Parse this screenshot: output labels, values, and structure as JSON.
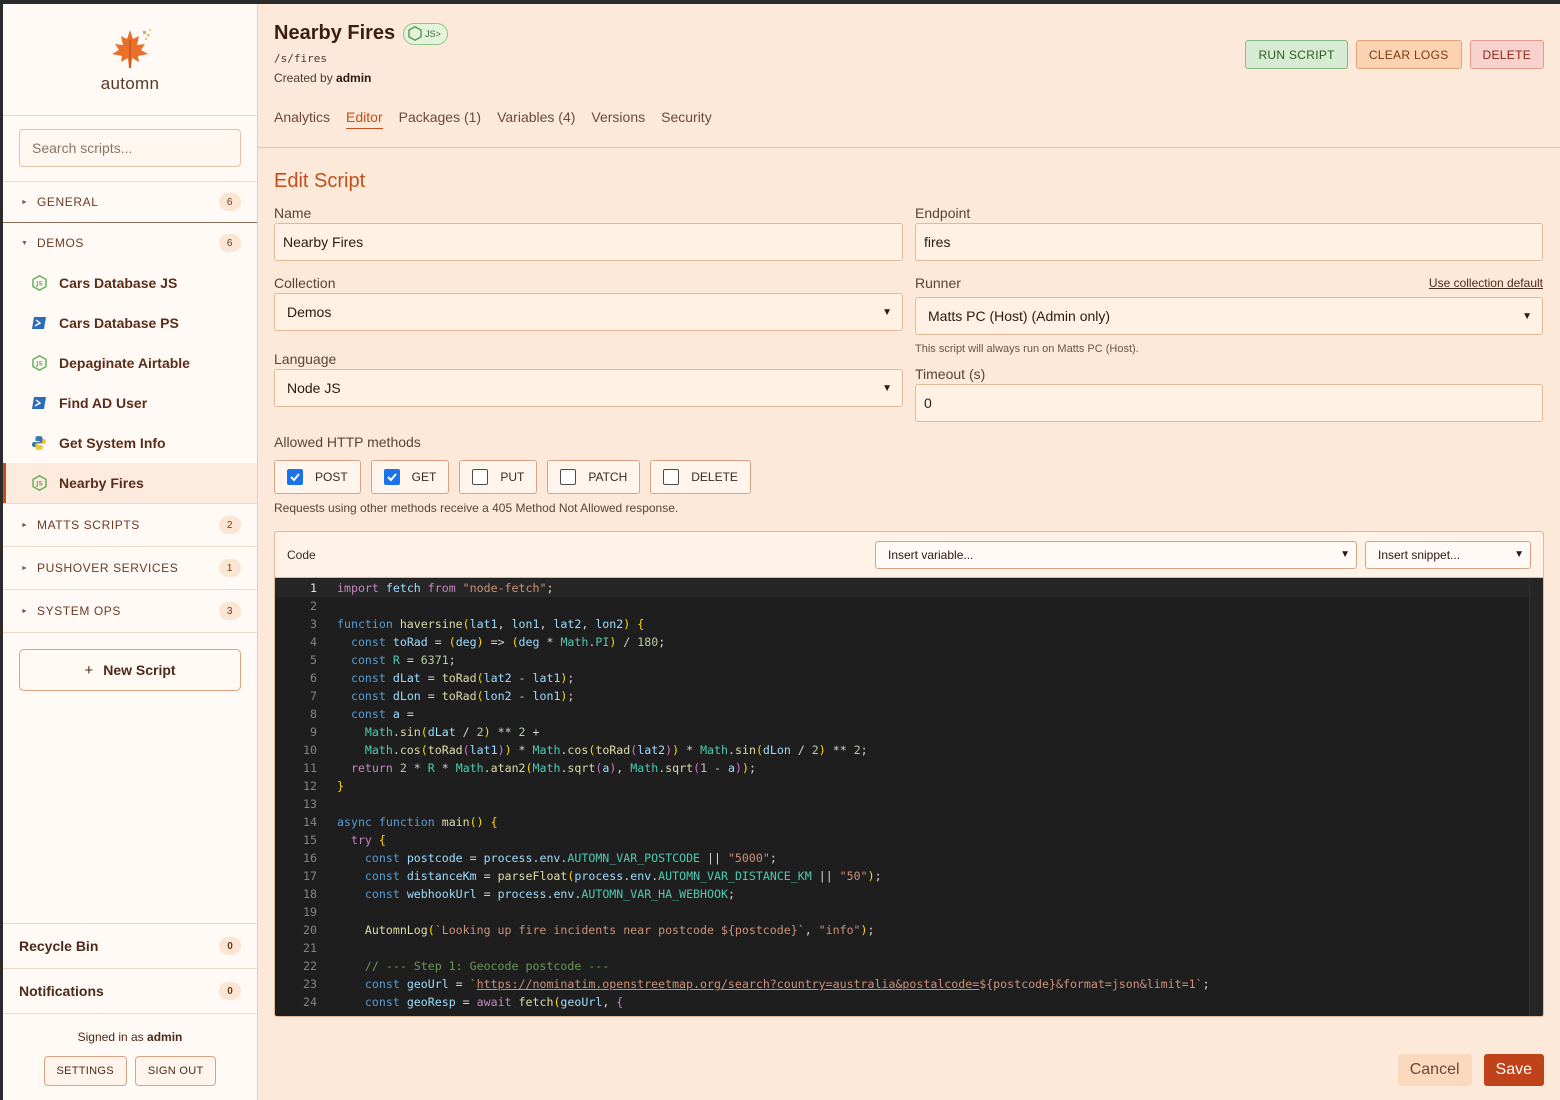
{
  "app": {
    "name": "automn"
  },
  "sidebar": {
    "search_placeholder": "Search scripts...",
    "groups": [
      {
        "label": "GENERAL",
        "count": "6",
        "expanded": false
      },
      {
        "label": "DEMOS",
        "count": "6",
        "expanded": true,
        "items": [
          {
            "label": "Cars Database JS",
            "icon": "nodejs-icon"
          },
          {
            "label": "Cars Database PS",
            "icon": "powershell-icon"
          },
          {
            "label": "Depaginate Airtable",
            "icon": "nodejs-icon"
          },
          {
            "label": "Find AD User",
            "icon": "powershell-icon"
          },
          {
            "label": "Get System Info",
            "icon": "python-icon"
          },
          {
            "label": "Nearby Fires",
            "icon": "nodejs-icon",
            "active": true
          }
        ]
      },
      {
        "label": "MATTS SCRIPTS",
        "count": "2",
        "expanded": false
      },
      {
        "label": "PUSHOVER SERVICES",
        "count": "1",
        "expanded": false
      },
      {
        "label": "SYSTEM OPS",
        "count": "3",
        "expanded": false
      }
    ],
    "new_script_label": "New Script",
    "recycle_bin": {
      "label": "Recycle Bin",
      "count": "0"
    },
    "notifications": {
      "label": "Notifications",
      "count": "0"
    },
    "signed_in_prefix": "Signed in as",
    "signed_in_user": "admin",
    "settings_label": "SETTINGS",
    "sign_out_label": "SIGN OUT"
  },
  "header": {
    "title": "Nearby Fires",
    "lang_badge": "JS>",
    "path": "/s/fires",
    "created_prefix": "Created by",
    "created_by": "admin",
    "actions": {
      "run": "RUN SCRIPT",
      "clear": "CLEAR LOGS",
      "delete": "DELETE"
    },
    "tabs": [
      "Analytics",
      "Editor",
      "Packages (1)",
      "Variables (4)",
      "Versions",
      "Security"
    ],
    "active_tab": "Editor"
  },
  "form": {
    "section_title": "Edit Script",
    "name": {
      "label": "Name",
      "value": "Nearby Fires"
    },
    "endpoint": {
      "label": "Endpoint",
      "value": "fires"
    },
    "collection": {
      "label": "Collection",
      "value": "Demos"
    },
    "runner": {
      "label": "Runner",
      "link": "Use collection default",
      "value": "Matts PC (Host) (Admin only)",
      "help": "This script will always run on Matts PC (Host)."
    },
    "language": {
      "label": "Language",
      "value": "Node JS"
    },
    "timeout": {
      "label": "Timeout (s)",
      "value": "0"
    },
    "methods_label": "Allowed HTTP methods",
    "methods": [
      {
        "label": "POST",
        "checked": true
      },
      {
        "label": "GET",
        "checked": true
      },
      {
        "label": "PUT",
        "checked": false
      },
      {
        "label": "PATCH",
        "checked": false
      },
      {
        "label": "DELETE",
        "checked": false
      }
    ],
    "methods_help": "Requests using other methods receive a 405 Method Not Allowed response."
  },
  "code": {
    "label": "Code",
    "insert_variable": "Insert variable...",
    "insert_snippet": "Insert snippet...",
    "lines": [
      "import fetch from \"node-fetch\";",
      "",
      "function haversine(lat1, lon1, lat2, lon2) {",
      "  const toRad = (deg) => (deg * Math.PI) / 180;",
      "  const R = 6371;",
      "  const dLat = toRad(lat2 - lat1);",
      "  const dLon = toRad(lon2 - lon1);",
      "  const a =",
      "    Math.sin(dLat / 2) ** 2 +",
      "    Math.cos(toRad(lat1)) * Math.cos(toRad(lat2)) * Math.sin(dLon / 2) ** 2;",
      "  return 2 * R * Math.atan2(Math.sqrt(a), Math.sqrt(1 - a));",
      "}",
      "",
      "async function main() {",
      "  try {",
      "    const postcode = process.env.AUTOMN_VAR_POSTCODE || \"5000\";",
      "    const distanceKm = parseFloat(process.env.AUTOMN_VAR_DISTANCE_KM || \"50\");",
      "    const webhookUrl = process.env.AUTOMN_VAR_HA_WEBHOOK;",
      "",
      "    AutomnLog(`Looking up fire incidents near postcode ${postcode}`, \"info\");",
      "",
      "    // --- Step 1: Geocode postcode ---",
      "    const geoUrl = `https://nominatim.openstreetmap.org/search?country=australia&postalcode=${postcode}&format=json&limit=1`;",
      "    const geoResp = await fetch(geoUrl, {"
    ]
  },
  "footer": {
    "cancel": "Cancel",
    "save": "Save"
  },
  "colors": {
    "accent": "#c0501a",
    "background": "#fde9d9",
    "sidebar": "#fffaf6",
    "editor": "#1e1e1e"
  }
}
